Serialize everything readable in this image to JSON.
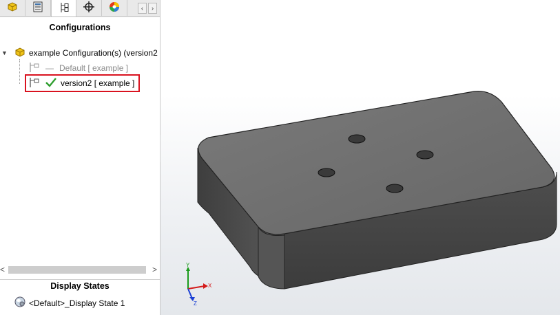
{
  "panel": {
    "tabs": [
      {
        "name": "feature-manager",
        "icon": "part-icon"
      },
      {
        "name": "property-manager",
        "icon": "property-sheet-icon"
      },
      {
        "name": "configuration-manager",
        "icon": "configuration-tree-icon"
      },
      {
        "name": "dimxpert-manager",
        "icon": "crosshair-icon"
      },
      {
        "name": "display-manager",
        "icon": "color-wheel-icon"
      }
    ],
    "title": "Configurations",
    "root_label": "example Configuration(s)  (version2",
    "configs": [
      {
        "label": "Default [ example ]",
        "active": false
      },
      {
        "label": "version2 [ example ]",
        "active": true
      }
    ],
    "display_states_title": "Display States",
    "display_state": "<Default>_Display State 1",
    "scroll_left": "‹",
    "scroll_right": "›",
    "hscroll_left": "<",
    "hscroll_right": ">"
  },
  "triad": {
    "x_label": "X",
    "y_label": "Y",
    "z_label": "Z"
  },
  "colors": {
    "highlight": "#d9121f",
    "check": "#2e9e2e",
    "model_top": "#6e6e6e",
    "model_front": "#4a4a4a",
    "axis_x": "#d41a1a",
    "axis_y": "#1a9b1a",
    "axis_z": "#1a3fd4"
  }
}
